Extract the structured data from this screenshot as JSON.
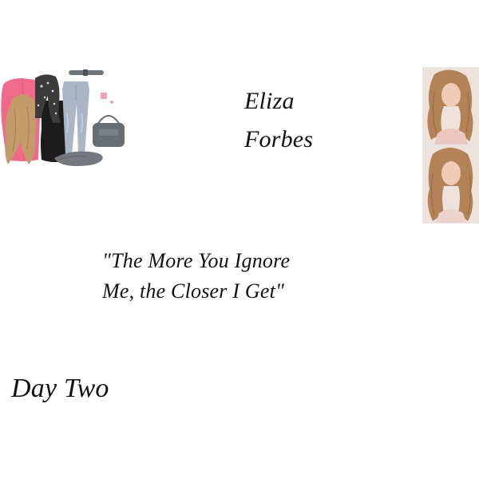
{
  "board": {
    "name_first": "Eliza",
    "name_last": "Forbes",
    "quote_line1": "\"The More You Ignore",
    "quote_line2": "Me, the Closer I Get\"",
    "day_label": "Day Two"
  },
  "collage": {
    "items": [
      "cardigan",
      "scarf",
      "top",
      "jeans",
      "belt",
      "earrings",
      "handbag",
      "flats",
      "hair"
    ],
    "colors": {
      "cardigan": "#f06b8b",
      "scarf": "#3b3b3b",
      "top": "#1c1c1c",
      "jeans": "#aab6c6",
      "belt": "#6f747a",
      "earrings": "#f2a0b4",
      "handbag": "#686d73",
      "flats": "#75797d",
      "hair": "#c39b6b"
    }
  },
  "photos": {
    "colors": {
      "hair": "#b38357",
      "skin": "#f0cbb6",
      "background": "#ede3dc",
      "clothing": "#e9c6c0"
    }
  }
}
